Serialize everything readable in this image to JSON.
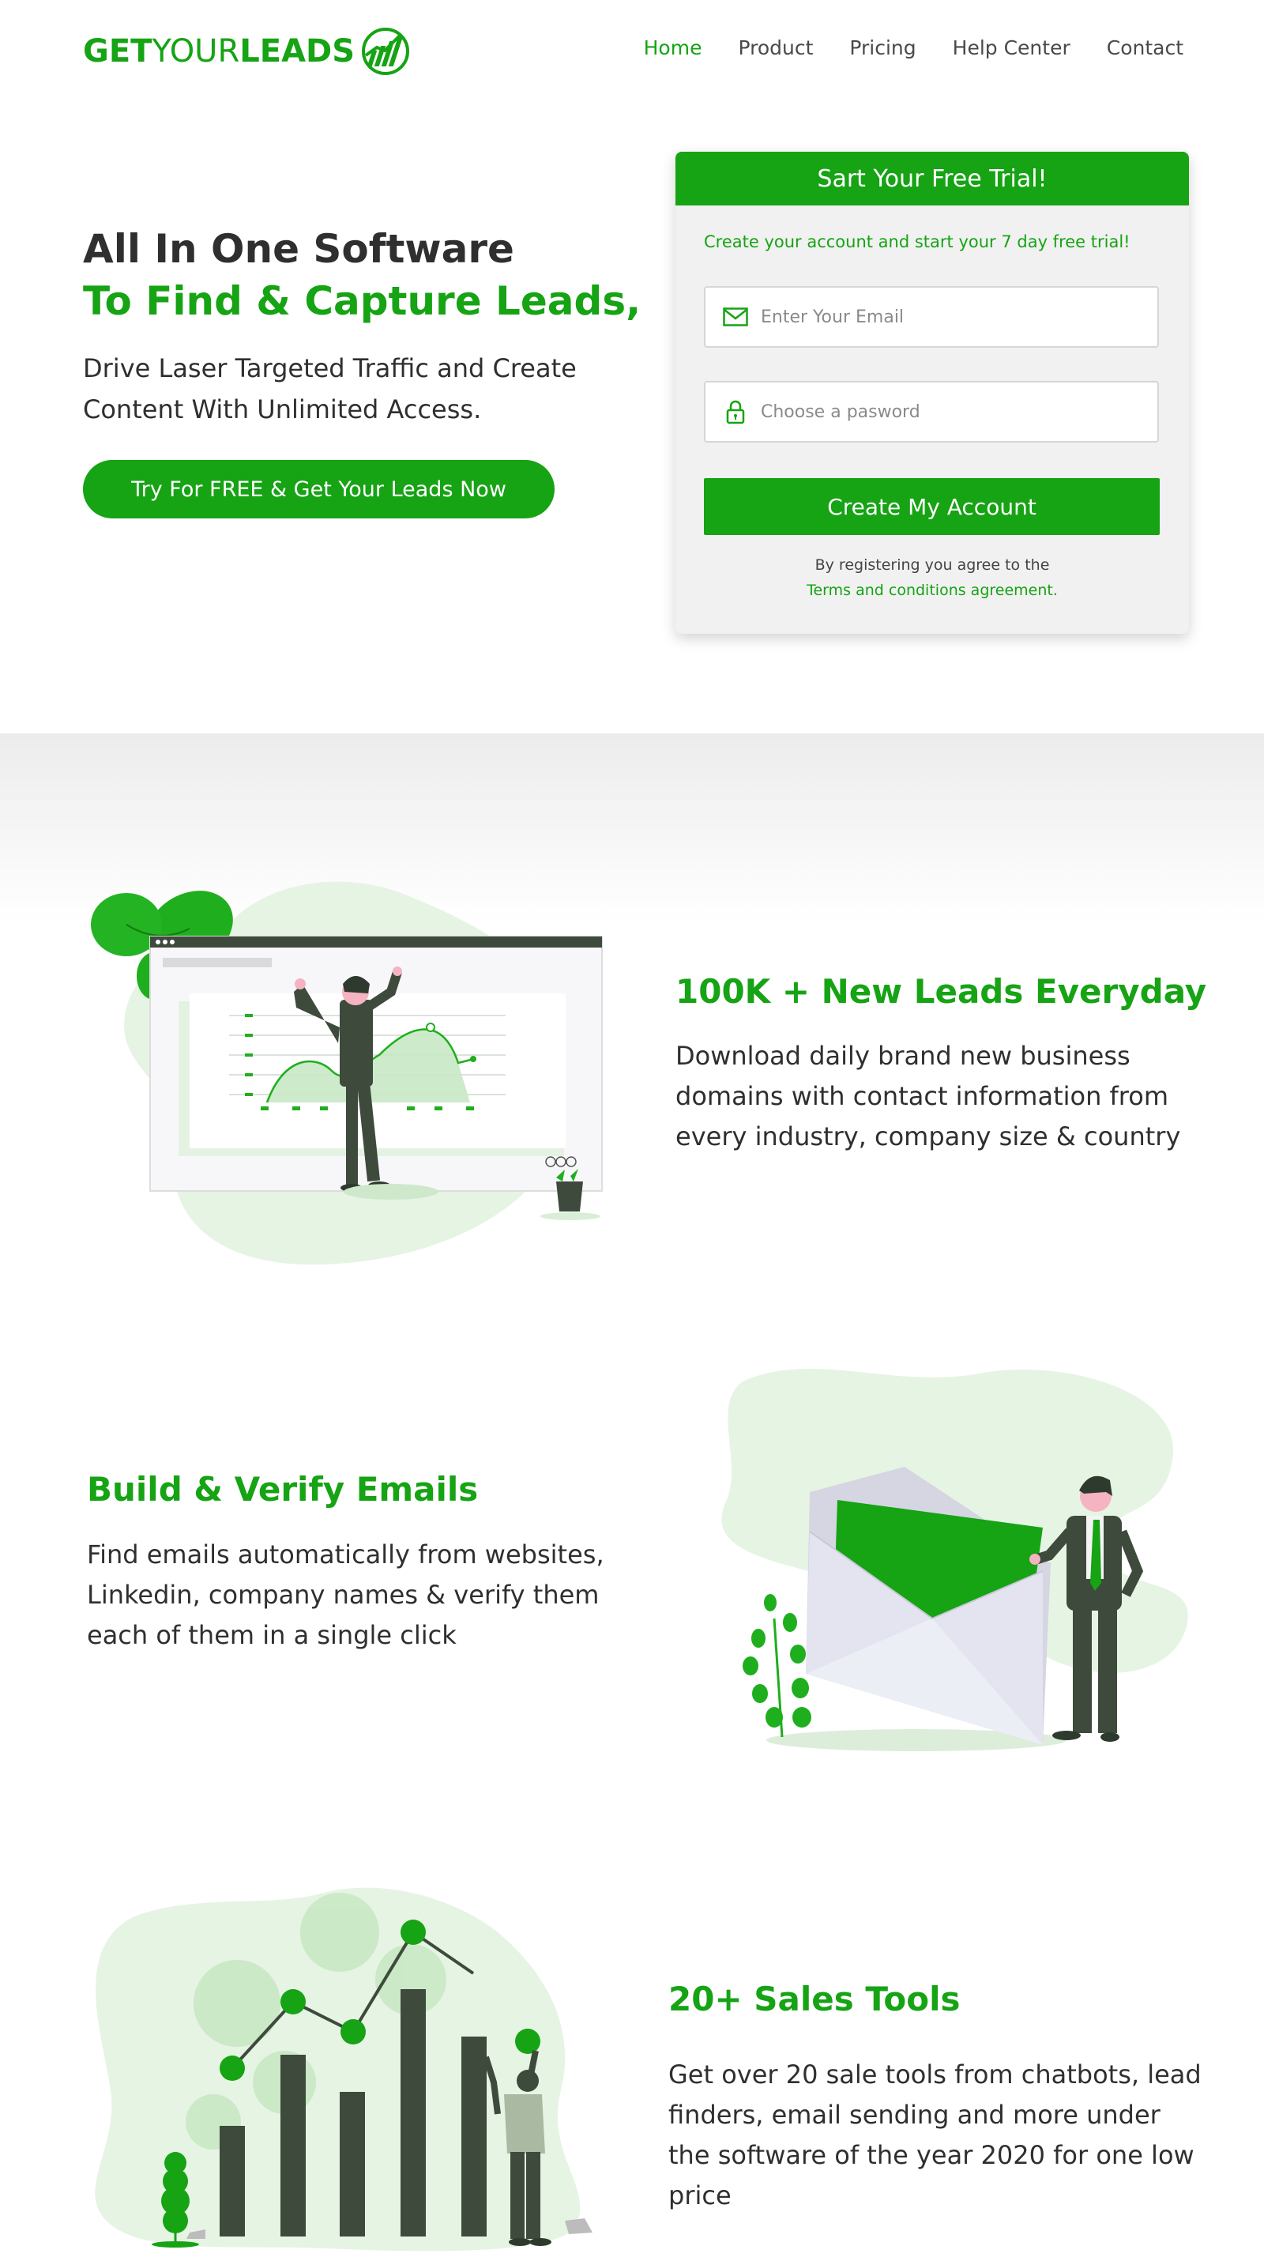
{
  "brand": {
    "logo_bold_1": "GET",
    "logo_light": "YOUR",
    "logo_bold_2": "LEADS",
    "accent_color": "#16a314"
  },
  "nav": {
    "items": [
      {
        "label": "Home",
        "active": true
      },
      {
        "label": "Product",
        "active": false
      },
      {
        "label": "Pricing",
        "active": false
      },
      {
        "label": "Help Center",
        "active": false
      },
      {
        "label": "Contact",
        "active": false
      }
    ]
  },
  "hero": {
    "title_line_1": "All In One Software",
    "title_line_2": "To Find & Capture Leads,",
    "subtitle": "Drive Laser Targeted Traffic and Create Content With Unlimited Access.",
    "cta_label": "Try For FREE & Get Your Leads Now"
  },
  "signup": {
    "heading": "Sart Your Free Trial!",
    "intro": "Create your account and start your 7 day free trial!",
    "email_placeholder": "Enter Your Email",
    "password_placeholder": "Choose a pasword",
    "submit_label": "Create My Account",
    "note": "By registering you agree to the",
    "terms_link": "Terms and conditions agreement."
  },
  "features": [
    {
      "title": "100K + New Leads Everyday",
      "text": "Download daily brand new business domains with contact information from every industry, company size & country",
      "icon": "analytics-illustration"
    },
    {
      "title": "Build & Verify Emails",
      "text": "Find emails automatically from websites, Linkedin, company names & verify them each of them in a single click",
      "icon": "envelope-illustration"
    },
    {
      "title": "20+ Sales Tools",
      "text": "Get over 20 sale tools from chatbots, lead finders, email sending and more under the software of the year 2020 for one low price",
      "icon": "growth-chart-illustration"
    }
  ]
}
